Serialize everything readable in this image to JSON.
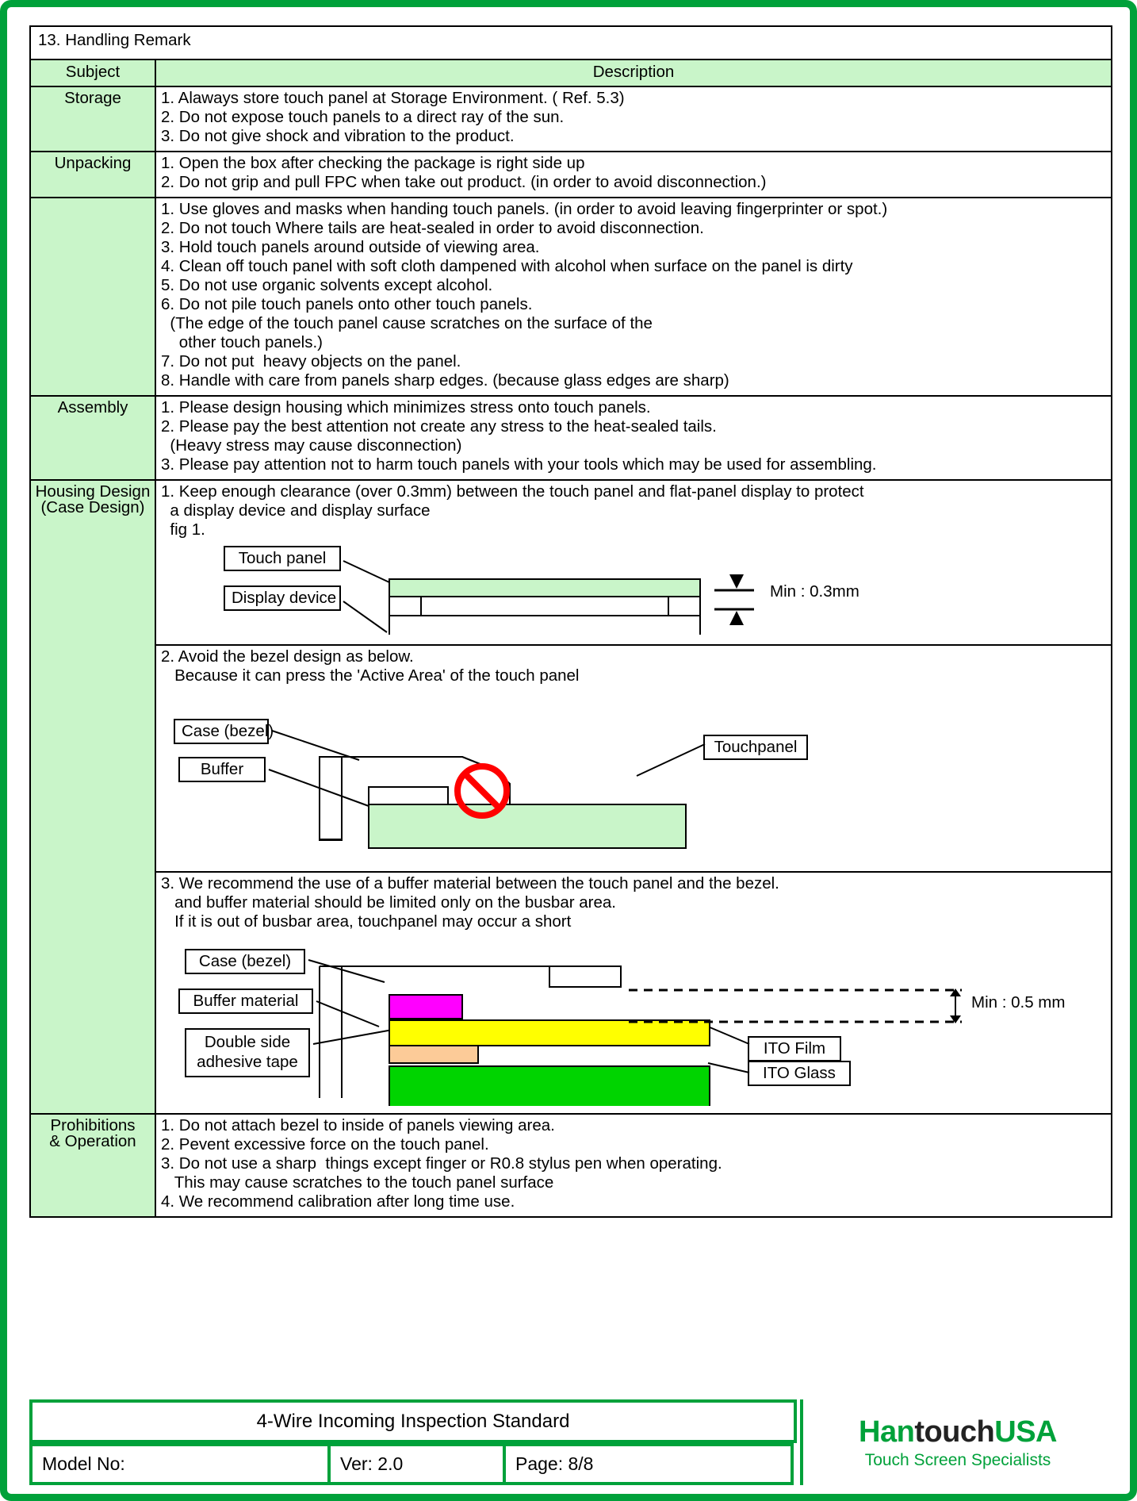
{
  "doc": {
    "section_title": "13. Handling Remark",
    "col_headers": {
      "subject": "Subject",
      "description": "Description"
    }
  },
  "rows": {
    "storage": {
      "subject": "Storage",
      "lines": [
        "1. Alaways store touch panel at Storage Environment. ( Ref. 5.3)",
        "2. Do not expose touch panels to a direct ray of the sun.",
        "3. Do not give shock and vibration to the product."
      ]
    },
    "unpacking": {
      "subject": "Unpacking",
      "lines": [
        "1. Open the box after checking the package is right side up",
        "2. Do not grip and pull FPC when take out product. (in order to avoid disconnection.)"
      ]
    },
    "handling": {
      "subject": "",
      "lines": [
        "1. Use gloves and masks when handing touch panels. (in order to avoid leaving fingerprinter or spot.)",
        "2. Do not touch Where tails are heat-sealed in order to avoid disconnection.",
        "3. Hold touch panels around outside of viewing area.",
        "4. Clean off touch panel with soft cloth dampened with alcohol when surface on the panel is dirty",
        "5. Do not use organic solvents except alcohol.",
        "6. Do not pile touch panels onto other touch panels.",
        "  (The edge of the touch panel cause scratches on the surface of the",
        "    other touch panels.)",
        "7. Do not put  heavy objects on the panel.",
        "8. Handle with care from panels sharp edges. (because glass edges are sharp)"
      ]
    },
    "assembly": {
      "subject": "Assembly",
      "lines": [
        "1. Please design housing which minimizes stress onto touch panels.",
        "2. Please pay the best attention not create any stress to the heat-sealed tails.",
        "  (Heavy stress may cause disconnection)",
        "3. Please pay attention not to harm touch panels with your tools which may be used for assembling."
      ]
    },
    "housing": {
      "subject_line1": "Housing Design",
      "subject_line2": "(Case Design)",
      "fig1": {
        "lines": [
          "1. Keep enough clearance (over 0.3mm) between the touch panel and flat-panel display to protect",
          "  a display device and display surface",
          "  fig 1."
        ],
        "labels": {
          "touch_panel": "Touch panel",
          "display_device": "Display device",
          "dimension": "Min : 0.3mm"
        }
      },
      "fig2": {
        "lines": [
          "2. Avoid the bezel design as below.",
          "   Because it can press the 'Active Area' of the touch panel"
        ],
        "labels": {
          "case_bezel": "Case (bezel)",
          "buffer": "Buffer",
          "touchpanel": "Touchpanel",
          "prohibited": "prohibition-symbol"
        }
      },
      "fig3": {
        "lines": [
          "3. We recommend the use of a buffer material between the touch panel and the bezel.",
          "   and buffer material should be limited only on the busbar area.",
          "   If it is out of busbar area, touchpanel may occur a short"
        ],
        "labels": {
          "case_bezel": "Case (bezel)",
          "buffer_material": "Buffer material",
          "adhesive_line1": "Double side",
          "adhesive_line2": "adhesive tape",
          "ito_film": "ITO Film",
          "ito_glass": "ITO Glass",
          "dimension": "Min : 0.5 mm"
        }
      }
    },
    "prohibitions": {
      "subject_line1": "Prohibitions",
      "subject_line2": "& Operation",
      "lines": [
        "1. Do not attach bezel to inside of panels viewing area.",
        "2. Pevent excessive force on the touch panel.",
        "3. Do not use a sharp  things except finger or R0.8 stylus pen when operating.",
        "   This may cause scratches to the touch panel surface",
        "4. We recommend calibration after long time use."
      ]
    }
  },
  "footer": {
    "title": "4-Wire Incoming Inspection Standard",
    "model_no": "Model No:",
    "version": "Ver: 2.0",
    "page": "Page: 8/8",
    "logo": {
      "han": "Han",
      "touch": "touch",
      "usa": "USA",
      "tagline": "Touch Screen Specialists"
    }
  },
  "colors": {
    "brand_green": "#00a13a",
    "cell_green": "#c9f5c9",
    "panel_green": "#00d400",
    "layer_magenta": "#ff00ff",
    "layer_yellow": "#ffff00",
    "layer_peach": "#fccb98",
    "prohibit_red": "#ff0000"
  }
}
